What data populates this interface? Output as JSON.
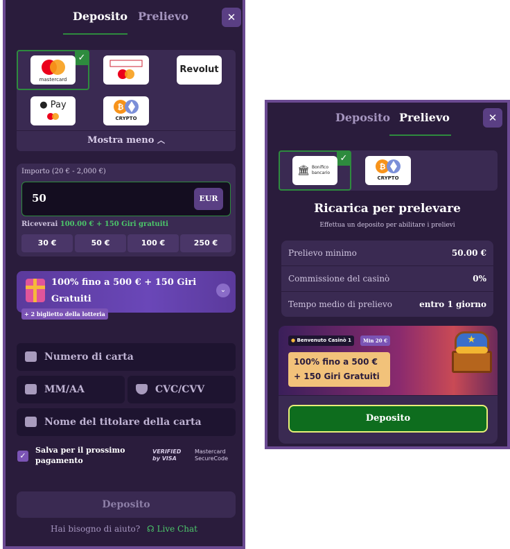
{
  "deposit_panel": {
    "tabs": {
      "deposit": "Deposito",
      "withdraw": "Prelievo"
    },
    "methods": [
      {
        "name": "mastercard",
        "label": "mastercard"
      },
      {
        "name": "maestro",
        "label": "maestro"
      },
      {
        "name": "revolut",
        "label": "Revolut"
      },
      {
        "name": "apple-pay",
        "label": "Pay"
      },
      {
        "name": "crypto",
        "label": "CRYPTO"
      }
    ],
    "show_less": "Mostra meno",
    "amount_label": "Importo (20 € - 2,000 €)",
    "amount_value": "50",
    "currency": "EUR",
    "receive_prefix": "Riceverai",
    "receive_value": "100.00 € + 150 Giri gratuiti",
    "quick_amounts": [
      "30 €",
      "50 €",
      "100 €",
      "250 €"
    ],
    "bonus_text": "100% fino a 500 € + 150 Giri Gratuiti",
    "lottery": "+ 2 biglietto della lotteria",
    "card_number_placeholder": "Numero di carta",
    "expiry_placeholder": "MM/AA",
    "cvc_placeholder": "CVC/CVV",
    "holder_placeholder": "Nome del titolare della carta",
    "save_label": "Salva per il prossimo pagamento",
    "verified_visa": "VERIFIED by VISA",
    "mc_securecode": "Mastercard SecureCode",
    "submit": "Deposito",
    "help_text": "Hai bisogno di aiuto?",
    "live_chat": "Live Chat"
  },
  "withdraw_panel": {
    "tabs": {
      "deposit": "Deposito",
      "withdraw": "Prelievo"
    },
    "methods": [
      {
        "name": "bank-transfer",
        "label": "Bonifico bancario"
      },
      {
        "name": "crypto",
        "label": "CRYPTO"
      }
    ],
    "title": "Ricarica per prelevare",
    "subtitle": "Effettua un deposito per abilitare i prelievi",
    "info_rows": [
      {
        "label": "Prelievo minimo",
        "value": "50.00 €"
      },
      {
        "label": "Commissione del casinò",
        "value": "0%"
      },
      {
        "label": "Tempo medio di prelievo",
        "value": "entro 1 giorno"
      }
    ],
    "promo_badge": "Benvenuto Casinò 1",
    "promo_min": "Min 20 €",
    "promo_text": "100% fino a 500 € + 150 Giri Gratuiti",
    "submit": "Deposito"
  },
  "colors": {
    "panel_bg": "#2a1c3c",
    "border": "#6b4a92",
    "green": "#2e8b3e",
    "accent_text": "#4cc76a"
  }
}
